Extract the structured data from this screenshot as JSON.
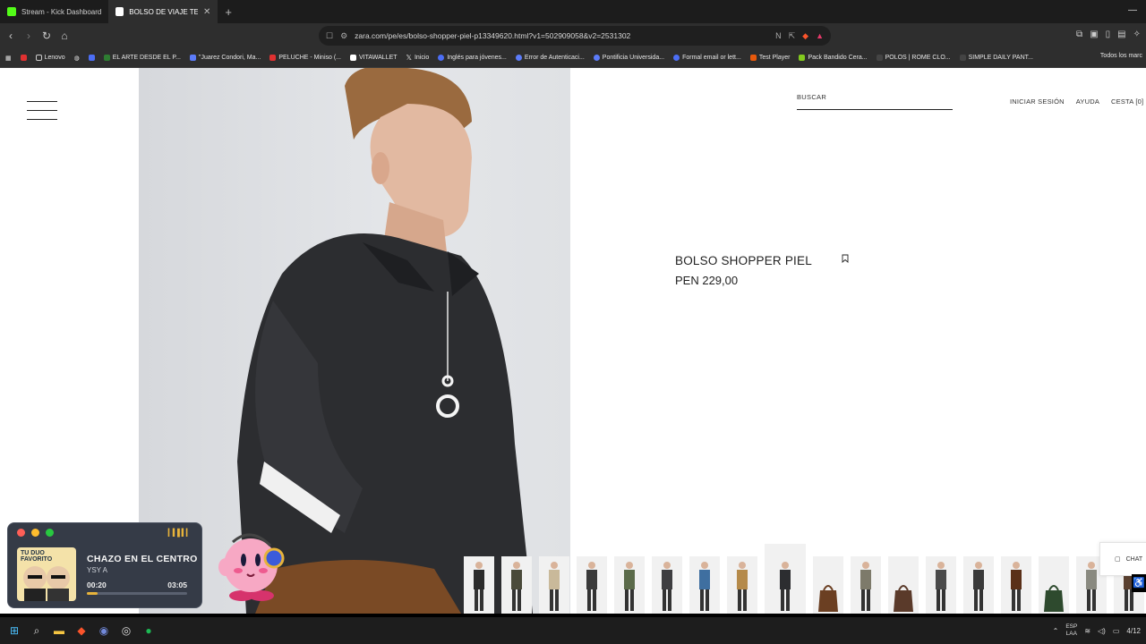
{
  "browser": {
    "tabs": [
      {
        "label": "Stream - Kick Dashboard",
        "active": false,
        "favicon_color": "#53fc18"
      },
      {
        "label": "BOLSO DE VIAJE TEXTURA - Ma",
        "active": true,
        "favicon_color": "#ffffff"
      }
    ],
    "new_tab_label": "+",
    "url": "zara.com/pe/es/bolso-shopper-piel-p13349620.html?v1=502909058&v2=2531302",
    "bookmarks": [
      {
        "label": "Lenovo",
        "color": "#cccccc"
      },
      {
        "label": "EL ARTE DESDE EL P...",
        "color": "#2e7d32"
      },
      {
        "label": "\"Juarez Condori, Ma...",
        "color": "#5c7cfa"
      },
      {
        "label": "PELUCHE - Miniso (...",
        "color": "#e03131"
      },
      {
        "label": "VITAWALLET",
        "color": "#ffffff"
      },
      {
        "label": "Inicio",
        "color": "#ffffff"
      },
      {
        "label": "Inglés para jóvenes...",
        "color": "#4c6ef5"
      },
      {
        "label": "Error de Autenticaci...",
        "color": "#5c7cfa"
      },
      {
        "label": "Pontificia Universida...",
        "color": "#5c7cfa"
      },
      {
        "label": "Formal email or lett...",
        "color": "#4c6ef5"
      },
      {
        "label": "Test Player",
        "color": "#e8590c"
      },
      {
        "label": "Pack Bandido Cera...",
        "color": "#82c91e"
      },
      {
        "label": "POLOS | ROME CLO...",
        "color": "#444444"
      },
      {
        "label": "SIMPLE DAILY PANT...",
        "color": "#444444"
      }
    ],
    "bookmarks_overflow": "Todos los marc"
  },
  "site": {
    "search_label": "BUSCAR",
    "top_links": [
      "INICIAR SESIÓN",
      "AYUDA",
      "CESTA [0]"
    ],
    "product_name": "BOLSO SHOPPER PIEL",
    "product_price": "PEN 229,00",
    "chat_label": "CHAT",
    "thumbnail_count": 18,
    "selected_thumbnail": 9
  },
  "player": {
    "cover_text": "TU DUO FAVORITO",
    "song": "CHAZO EN EL CENTRO",
    "artist": "YSY A",
    "time_current": "00:20",
    "time_total": "03:05",
    "progress": 0.11
  },
  "taskbar": {
    "lang_line1": "ESP",
    "lang_line2": "LAA",
    "date_fragment": "4/12"
  }
}
